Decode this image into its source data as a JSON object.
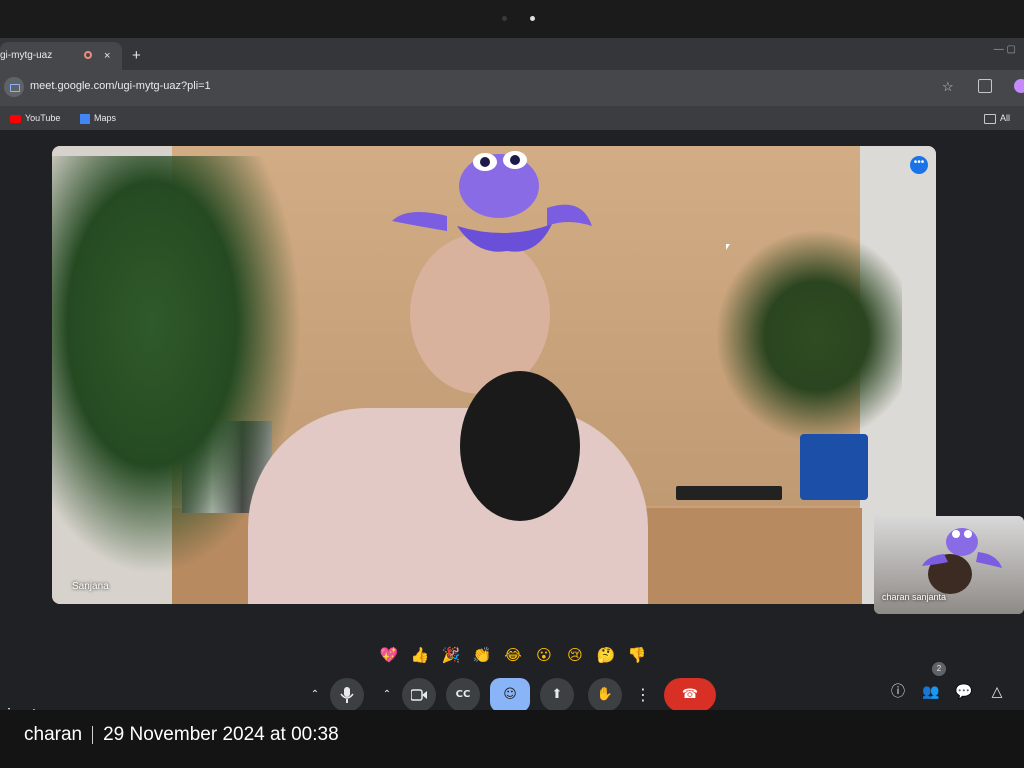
{
  "browser": {
    "tab_title": "gi-mytg-uaz",
    "tab_close": "×",
    "new_tab": "+",
    "url": "meet.google.com/ugi-mytg-uaz?pli=1",
    "bookmarks": [
      {
        "label": "YouTube"
      },
      {
        "label": "Maps"
      }
    ],
    "all_bookmarks": "All Boo"
  },
  "meet": {
    "main_participant": "Sanjana",
    "self_participant": "charan sanjanta",
    "meeting_code": "gi-mytg-uaz",
    "participant_count": "2",
    "reactions": [
      "💖",
      "👍",
      "🎉",
      "👏",
      "😂",
      "😮",
      "😢",
      "🤔",
      "👎"
    ],
    "controls": [
      {
        "name": "mic-options",
        "glyph": "⌃"
      },
      {
        "name": "mic",
        "glyph": "🎤"
      },
      {
        "name": "camera-options",
        "glyph": "⌃"
      },
      {
        "name": "camera",
        "glyph": "▶"
      },
      {
        "name": "captions",
        "glyph": "CC"
      },
      {
        "name": "emoji-reactions",
        "glyph": "☺"
      },
      {
        "name": "present",
        "glyph": "⬆"
      },
      {
        "name": "raise-hand",
        "glyph": "✋"
      },
      {
        "name": "more-options",
        "glyph": "⋮"
      },
      {
        "name": "leave-call",
        "glyph": "☎"
      }
    ],
    "right_controls": [
      {
        "name": "meeting-details",
        "glyph": "ⓘ"
      },
      {
        "name": "people",
        "glyph": "👥"
      },
      {
        "name": "chat",
        "glyph": "💬"
      },
      {
        "name": "activities",
        "glyph": "△"
      }
    ],
    "colors": {
      "accent": "#8ab4f8",
      "end_call": "#d93025",
      "background": "#202124"
    }
  },
  "photo_stamp": {
    "user": "charan",
    "datetime": "29 November 2024 at 00:38"
  }
}
